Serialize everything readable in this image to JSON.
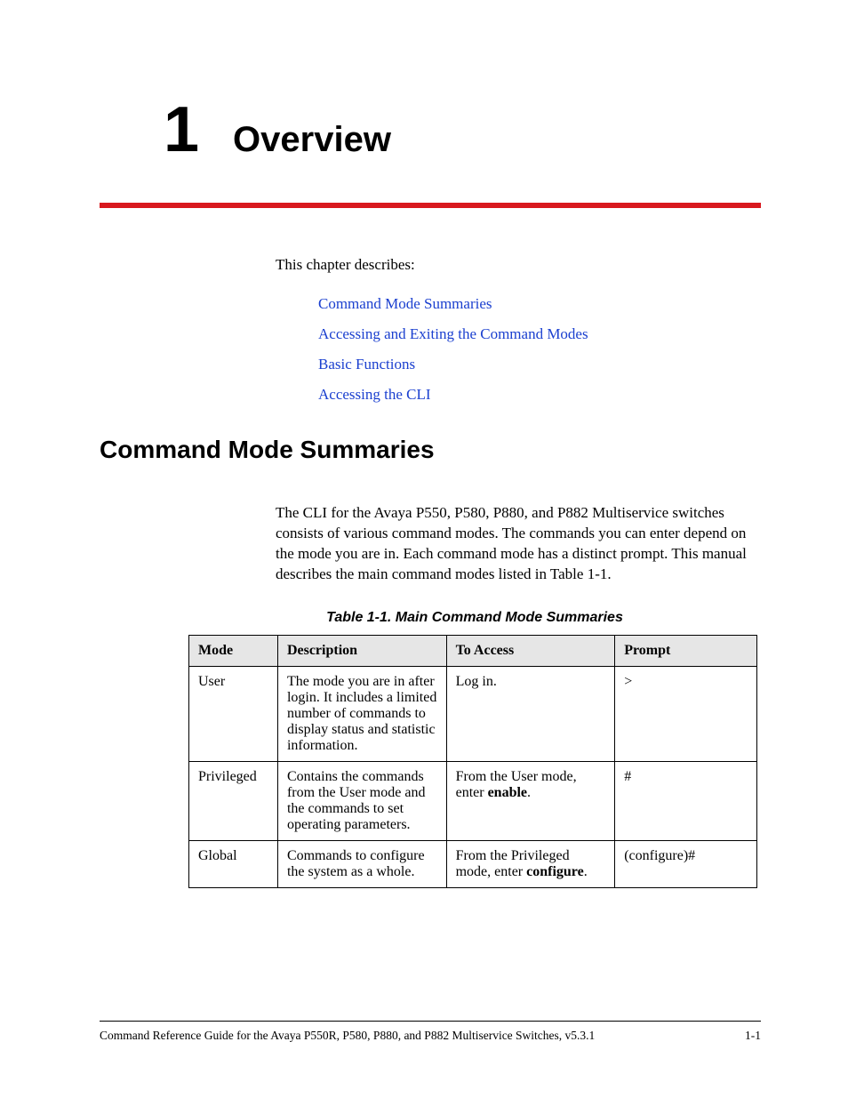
{
  "chapter": {
    "number": "1",
    "title": "Overview"
  },
  "intro": "This chapter describes:",
  "toc": [
    "Command Mode Summaries",
    "Accessing and Exiting the Command Modes",
    "Basic Functions",
    "Accessing the CLI"
  ],
  "section": {
    "title": "Command Mode Summaries",
    "body": "The CLI for the Avaya P550, P580, P880, and P882 Multiservice switches consists of various command modes. The commands you can enter depend on the mode you are in. Each command mode has a distinct prompt. This manual describes the main command modes listed in Table 1-1."
  },
  "table": {
    "caption": "Table 1-1.  Main Command Mode Summaries",
    "headers": [
      "Mode",
      "Description",
      "To Access",
      "Prompt"
    ],
    "rows": [
      {
        "mode": "User",
        "description": "The mode you are in after login. It includes a limited number of commands to display status and statistic information.",
        "access_pre": "Log in.",
        "access_bold": "",
        "access_post": "",
        "prompt": ">"
      },
      {
        "mode": "Privileged",
        "description": "Contains the commands from the User mode and the commands to set operating parameters.",
        "access_pre": "From the User mode, enter ",
        "access_bold": "enable",
        "access_post": ".",
        "prompt": "#"
      },
      {
        "mode": "Global",
        "description": "Commands to configure the system as a whole.",
        "access_pre": "From the Privileged mode, enter ",
        "access_bold": "configure",
        "access_post": ".",
        "prompt": "(configure)#"
      }
    ]
  },
  "footer": {
    "left": "Command Reference Guide for the Avaya P550R, P580, P880, and P882 Multiservice Switches, v5.3.1",
    "right": "1-1"
  }
}
